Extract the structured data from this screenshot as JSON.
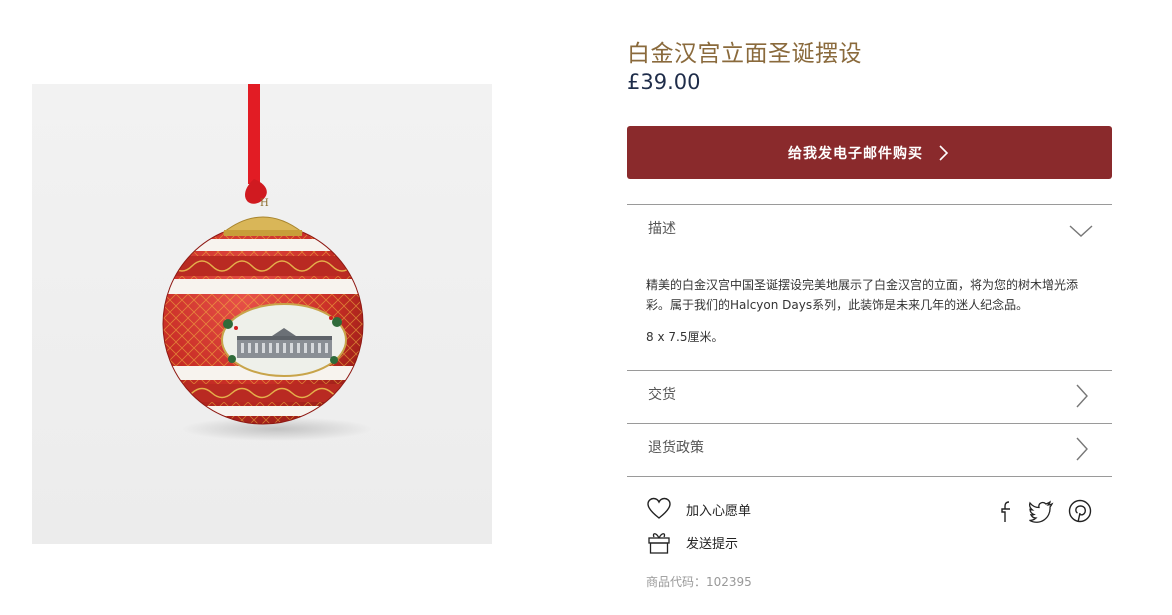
{
  "product": {
    "title": "白金汉宫立面圣诞摆设",
    "price": "£39.00",
    "image_alt": "Christmas bauble ornament"
  },
  "cta": {
    "label": "给我发电子邮件购买"
  },
  "accordion": {
    "description": {
      "label": "描述",
      "text": "精美的白金汉宫中国圣诞摆设完美地展示了白金汉宫的立面，将为您的树木增光添彩。属于我们的Halcyon Days系列，此装饰是未来几年的迷人纪念品。",
      "dimensions": "8 x 7.5厘米。",
      "state": "expanded"
    },
    "delivery": {
      "label": "交货"
    },
    "returns": {
      "label": "退货政策"
    }
  },
  "actions": {
    "wishlist": "加入心愿单",
    "gift": "发送提示"
  },
  "social": {
    "icons": [
      "facebook-icon",
      "twitter-icon",
      "pinterest-icon"
    ]
  },
  "sku": {
    "text": "商品代码：102395"
  },
  "colors": {
    "title": "#8a6a3c",
    "price": "#1f2d4a",
    "cta_bg": "#8a2a2c",
    "divider": "#9a9a9a"
  }
}
